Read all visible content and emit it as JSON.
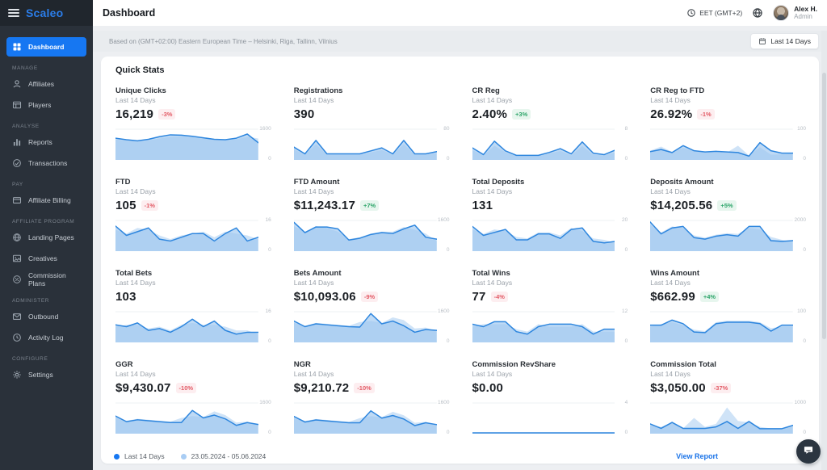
{
  "colors": {
    "accent_blue": "#1677f2",
    "chart_line": "#2e86de",
    "chart_fill_current": "#9cc6ef",
    "chart_fill_previous": "#cfe3f7",
    "badge_up": "#2da56a",
    "badge_down": "#e35b66",
    "sidebar_bg": "#2a313a"
  },
  "sidebar": {
    "logo": "Scaleo",
    "sections": [
      {
        "label": null,
        "items": [
          {
            "label": "Dashboard",
            "icon": "dashboard",
            "active": true
          }
        ]
      },
      {
        "label": "MANAGE",
        "items": [
          {
            "label": "Affiliates",
            "icon": "user"
          },
          {
            "label": "Players",
            "icon": "players"
          }
        ]
      },
      {
        "label": "ANALYSE",
        "items": [
          {
            "label": "Reports",
            "icon": "reports"
          },
          {
            "label": "Transactions",
            "icon": "transactions"
          }
        ]
      },
      {
        "label": "PAY",
        "items": [
          {
            "label": "Affiliate Billing",
            "icon": "credit-card"
          }
        ]
      },
      {
        "label": "AFFILIATE PROGRAM",
        "items": [
          {
            "label": "Landing Pages",
            "icon": "globe"
          },
          {
            "label": "Creatives",
            "icon": "image"
          },
          {
            "label": "Commission Plans",
            "icon": "percent-circle"
          }
        ]
      },
      {
        "label": "ADMINISTER",
        "items": [
          {
            "label": "Outbound",
            "icon": "mail"
          },
          {
            "label": "Activity Log",
            "icon": "history"
          }
        ]
      },
      {
        "label": "CONFIGURE",
        "items": [
          {
            "label": "Settings",
            "icon": "gear"
          }
        ]
      }
    ]
  },
  "header": {
    "title": "Dashboard",
    "timezone": "EET (GMT+2)",
    "user_name": "Alex H.",
    "user_role": "Admin"
  },
  "notice": {
    "text": "Based on (GMT+02:00) Eastern European Time – Helsinki, Riga, Tallinn, Vilnius",
    "range_button": "Last 14 Days"
  },
  "panel": {
    "title": "Quick Stats"
  },
  "footer": {
    "legend_current": "Last 14 Days",
    "legend_previous": "23.05.2024 - 05.06.2024",
    "view_report": "View Report"
  },
  "chart_data": [
    {
      "type": "area",
      "title": "Unique Clicks",
      "period": "Last 14 Days",
      "value": "16,219",
      "change": "-3%",
      "change_dir": "down",
      "axis_max": "1600",
      "ylim": [
        0,
        1600
      ],
      "series": [
        {
          "name": "Last 14 Days",
          "values": [
            1120,
            1040,
            980,
            1060,
            1200,
            1300,
            1280,
            1220,
            1140,
            1060,
            1040,
            1120,
            1340,
            880
          ]
        },
        {
          "name": "23.05.2024 - 05.06.2024",
          "values": [
            1050,
            1000,
            950,
            1000,
            1100,
            1200,
            1220,
            1180,
            1100,
            1020,
            1000,
            1060,
            1200,
            1100
          ]
        }
      ]
    },
    {
      "type": "area",
      "title": "Registrations",
      "period": "Last 14 Days",
      "value": "390",
      "change": null,
      "change_dir": null,
      "axis_max": "80",
      "ylim": [
        0,
        80
      ],
      "series": [
        {
          "name": "Last 14 Days",
          "values": [
            32,
            14,
            50,
            14,
            14,
            14,
            14,
            22,
            30,
            14,
            50,
            14,
            14,
            20
          ]
        },
        {
          "name": "23.05.2024 - 05.06.2024",
          "values": [
            26,
            12,
            40,
            12,
            12,
            12,
            12,
            18,
            24,
            12,
            40,
            12,
            12,
            16
          ]
        }
      ]
    },
    {
      "type": "area",
      "title": "CR Reg",
      "period": "Last 14 Days",
      "value": "2.40%",
      "change": "+3%",
      "change_dir": "up",
      "axis_max": "8",
      "ylim": [
        0,
        8
      ],
      "series": [
        {
          "name": "Last 14 Days",
          "values": [
            3,
            1.2,
            4.8,
            2.2,
            1,
            1,
            1,
            1.8,
            2.8,
            1.4,
            4.6,
            1.6,
            1.2,
            2.4
          ]
        },
        {
          "name": "23.05.2024 - 05.06.2024",
          "values": [
            2.4,
            1,
            3.6,
            1.8,
            0.8,
            0.8,
            0.8,
            1.5,
            2.2,
            1,
            3.5,
            1.2,
            1,
            1.8
          ]
        }
      ]
    },
    {
      "type": "area",
      "title": "CR Reg to FTD",
      "period": "Last 14 Days",
      "value": "26.92%",
      "change": "-1%",
      "change_dir": "down",
      "axis_max": "100",
      "ylim": [
        0,
        100
      ],
      "series": [
        {
          "name": "Last 14 Days",
          "values": [
            25,
            32,
            22,
            45,
            28,
            24,
            26,
            24,
            22,
            10,
            55,
            28,
            20,
            20
          ]
        },
        {
          "name": "23.05.2024 - 05.06.2024",
          "values": [
            28,
            42,
            24,
            38,
            26,
            22,
            24,
            22,
            45,
            12,
            40,
            15,
            16,
            18
          ]
        }
      ]
    },
    {
      "type": "area",
      "title": "FTD",
      "period": "Last 14 Days",
      "value": "105",
      "change": "-1%",
      "change_dir": "down",
      "axis_max": "16",
      "ylim": [
        0,
        16
      ],
      "series": [
        {
          "name": "Last 14 Days",
          "values": [
            13,
            8,
            10,
            12,
            6,
            5,
            7,
            9,
            9,
            5,
            9,
            12,
            5,
            7
          ]
        },
        {
          "name": "23.05.2024 - 05.06.2024",
          "values": [
            11,
            9,
            12,
            11,
            8,
            6,
            8,
            9,
            10,
            7,
            10,
            9,
            8,
            6
          ]
        }
      ]
    },
    {
      "type": "area",
      "title": "FTD Amount",
      "period": "Last 14 Days",
      "value": "$11,243.17",
      "change": "+7%",
      "change_dir": "up",
      "axis_max": "1600",
      "ylim": [
        0,
        1600
      ],
      "series": [
        {
          "name": "Last 14 Days",
          "values": [
            1500,
            950,
            1250,
            1250,
            1150,
            550,
            650,
            850,
            950,
            900,
            1150,
            1350,
            700,
            600
          ]
        },
        {
          "name": "23.05.2024 - 05.06.2024",
          "values": [
            1300,
            1000,
            1300,
            1200,
            1000,
            600,
            700,
            900,
            1000,
            1000,
            1250,
            1100,
            900,
            500
          ]
        }
      ]
    },
    {
      "type": "area",
      "title": "Total Deposits",
      "period": "Last 14 Days",
      "value": "131",
      "change": null,
      "change_dir": null,
      "axis_max": "20",
      "ylim": [
        0,
        20
      ],
      "series": [
        {
          "name": "Last 14 Days",
          "values": [
            16,
            10,
            12,
            14,
            7,
            7,
            11,
            11,
            8,
            14,
            15,
            6,
            5,
            6
          ]
        },
        {
          "name": "23.05.2024 - 05.06.2024",
          "values": [
            14,
            11,
            14,
            13,
            9,
            8,
            12,
            12,
            10,
            15,
            13,
            8,
            7,
            5
          ]
        }
      ]
    },
    {
      "type": "area",
      "title": "Deposits Amount",
      "period": "Last 14 Days",
      "value": "$14,205.56",
      "change": "+5%",
      "change_dir": "up",
      "axis_max": "2000",
      "ylim": [
        0,
        2000
      ],
      "series": [
        {
          "name": "Last 14 Days",
          "values": [
            1900,
            1100,
            1500,
            1600,
            850,
            750,
            950,
            1050,
            950,
            1600,
            1600,
            650,
            600,
            650
          ]
        },
        {
          "name": "23.05.2024 - 05.06.2024",
          "values": [
            1700,
            1200,
            1600,
            1500,
            1000,
            850,
            1050,
            1150,
            1100,
            1500,
            1400,
            900,
            700,
            550
          ]
        }
      ]
    },
    {
      "type": "area",
      "title": "Total Bets",
      "period": "Last 14 Days",
      "value": "103",
      "change": null,
      "change_dir": null,
      "axis_max": "16",
      "ylim": [
        0,
        16
      ],
      "series": [
        {
          "name": "Last 14 Days",
          "values": [
            9,
            8,
            10,
            6,
            7,
            5,
            8,
            12,
            8,
            11,
            6,
            4,
            5,
            5
          ]
        },
        {
          "name": "23.05.2024 - 05.06.2024",
          "values": [
            8,
            9,
            9,
            7,
            8,
            6,
            9,
            10,
            9,
            9,
            8,
            6,
            6,
            4
          ]
        }
      ]
    },
    {
      "type": "area",
      "title": "Bets Amount",
      "period": "Last 14 Days",
      "value": "$10,093.06",
      "change": "-9%",
      "change_dir": "down",
      "axis_max": "1600",
      "ylim": [
        0,
        1600
      ],
      "series": [
        {
          "name": "Last 14 Days",
          "values": [
            1100,
            800,
            950,
            900,
            850,
            800,
            780,
            1500,
            950,
            1100,
            850,
            500,
            650,
            600
          ]
        },
        {
          "name": "23.05.2024 - 05.06.2024",
          "values": [
            1000,
            850,
            1000,
            950,
            900,
            850,
            1050,
            1100,
            1000,
            1300,
            1150,
            700,
            750,
            550
          ]
        }
      ]
    },
    {
      "type": "area",
      "title": "Total Wins",
      "period": "Last 14 Days",
      "value": "77",
      "change": "-4%",
      "change_dir": "down",
      "axis_max": "12",
      "ylim": [
        0,
        12
      ],
      "series": [
        {
          "name": "Last 14 Days",
          "values": [
            7,
            6,
            8,
            8,
            4,
            3,
            6,
            7,
            7,
            7,
            6,
            3,
            5,
            5
          ]
        },
        {
          "name": "23.05.2024 - 05.06.2024",
          "values": [
            6,
            7,
            7,
            7,
            5,
            4,
            7,
            6,
            6,
            6,
            7,
            4,
            4,
            4
          ]
        }
      ]
    },
    {
      "type": "area",
      "title": "Wins Amount",
      "period": "Last 14 Days",
      "value": "$662.99",
      "change": "+4%",
      "change_dir": "up",
      "axis_max": "100",
      "ylim": [
        0,
        100
      ],
      "series": [
        {
          "name": "Last 14 Days",
          "values": [
            55,
            55,
            72,
            60,
            32,
            30,
            60,
            65,
            65,
            65,
            60,
            35,
            55,
            55
          ]
        },
        {
          "name": "23.05.2024 - 05.06.2024",
          "values": [
            50,
            58,
            65,
            55,
            40,
            35,
            65,
            70,
            70,
            70,
            65,
            45,
            50,
            50
          ]
        }
      ]
    },
    {
      "type": "area",
      "title": "GGR",
      "period": "Last 14 Days",
      "value": "$9,430.07",
      "change": "-10%",
      "change_dir": "down",
      "axis_max": "1600",
      "ylim": [
        0,
        1600
      ],
      "series": [
        {
          "name": "Last 14 Days",
          "values": [
            900,
            600,
            700,
            650,
            600,
            550,
            550,
            1200,
            800,
            950,
            750,
            400,
            550,
            450
          ]
        },
        {
          "name": "23.05.2024 - 05.06.2024",
          "values": [
            800,
            650,
            750,
            700,
            650,
            600,
            800,
            900,
            850,
            1150,
            950,
            550,
            600,
            400
          ]
        }
      ]
    },
    {
      "type": "area",
      "title": "NGR",
      "period": "Last 14 Days",
      "value": "$9,210.72",
      "change": "-10%",
      "change_dir": "down",
      "axis_max": "1600",
      "ylim": [
        0,
        1600
      ],
      "series": [
        {
          "name": "Last 14 Days",
          "values": [
            880,
            580,
            690,
            640,
            590,
            540,
            540,
            1180,
            790,
            930,
            740,
            390,
            540,
            440
          ]
        },
        {
          "name": "23.05.2024 - 05.06.2024",
          "values": [
            780,
            640,
            740,
            690,
            640,
            590,
            790,
            890,
            840,
            1130,
            940,
            540,
            590,
            390
          ]
        }
      ]
    },
    {
      "type": "area",
      "title": "Commission RevShare",
      "period": "Last 14 Days",
      "value": "$0.00",
      "change": null,
      "change_dir": null,
      "axis_max": "4",
      "ylim": [
        0,
        4
      ],
      "series": [
        {
          "name": "Last 14 Days",
          "values": [
            0,
            0,
            0,
            0,
            0,
            0,
            0,
            0,
            0,
            0,
            0,
            0,
            0,
            0
          ]
        },
        {
          "name": "23.05.2024 - 05.06.2024",
          "values": [
            0,
            0,
            0,
            0,
            0,
            0,
            0,
            0,
            0,
            0,
            0,
            0,
            0,
            0
          ]
        }
      ]
    },
    {
      "type": "area",
      "title": "Commission Total",
      "period": "Last 14 Days",
      "value": "$3,050.00",
      "change": "-37%",
      "change_dir": "down",
      "axis_max": "1000",
      "ylim": [
        0,
        1000
      ],
      "series": [
        {
          "name": "Last 14 Days",
          "values": [
            300,
            150,
            350,
            150,
            150,
            150,
            200,
            380,
            150,
            380,
            140,
            140,
            140,
            250
          ]
        },
        {
          "name": "23.05.2024 - 05.06.2024",
          "values": [
            250,
            200,
            350,
            150,
            500,
            200,
            300,
            850,
            400,
            350,
            200,
            150,
            150,
            200
          ]
        }
      ]
    }
  ]
}
